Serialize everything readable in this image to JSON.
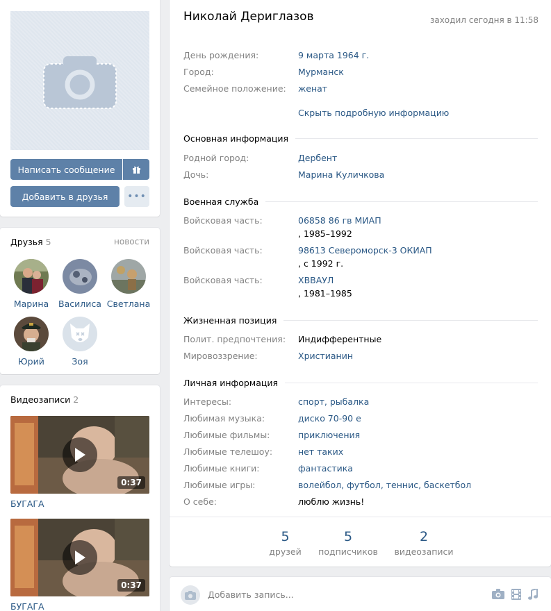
{
  "profile": {
    "name": "Николай Дериглазов",
    "online": "заходил сегодня в 11:58",
    "short_info": [
      {
        "label": "День рождения:",
        "value": "9 марта 1964 г."
      },
      {
        "label": "Город:",
        "value": "Мурманск"
      },
      {
        "label": "Семейное положение:",
        "value": "женат"
      }
    ],
    "toggle_details": "Скрыть подробную информацию",
    "sections": {
      "main": {
        "title": "Основная информация",
        "rows": [
          {
            "label": "Родной город:",
            "value": "Дербент"
          },
          {
            "label": "Дочь:",
            "value": "Марина Куличкова"
          }
        ]
      },
      "military": {
        "title": "Военная служба",
        "rows": [
          {
            "label": "Войсковая часть:",
            "value": "06858 86 гв МИАП",
            "years": ", 1985–1992"
          },
          {
            "label": "Войсковая часть:",
            "value": "98613 Североморск-3 ОКИАП",
            "years": ", с 1992 г."
          },
          {
            "label": "Войсковая часть:",
            "value": "ХВВАУЛ",
            "years": ", 1981–1985"
          }
        ]
      },
      "life": {
        "title": "Жизненная позиция",
        "rows": [
          {
            "label": "Полит. предпочтения:",
            "value": "Индифферентные"
          },
          {
            "label": "Мировоззрение:",
            "value": "Христианин"
          }
        ]
      },
      "personal": {
        "title": "Личная информация",
        "rows": [
          {
            "label": "Интересы:",
            "value": "спорт, рыбалка"
          },
          {
            "label": "Любимая музыка:",
            "value": "диско 70-90 е"
          },
          {
            "label": "Любимые фильмы:",
            "value": "приключения"
          },
          {
            "label": "Любимые телешоу:",
            "value": "нет таких"
          },
          {
            "label": "Любимые книги:",
            "value": "фантастика"
          },
          {
            "label": "Любимые игры:",
            "value": "волейбол, футбол, теннис, баскетбол"
          },
          {
            "label": "О себе:",
            "value": "люблю жизнь!"
          }
        ]
      }
    },
    "stats": [
      {
        "count": "5",
        "label": "друзей"
      },
      {
        "count": "5",
        "label": "подписчиков"
      },
      {
        "count": "2",
        "label": "видеозаписи"
      }
    ]
  },
  "actions": {
    "message": "Написать сообщение",
    "add_friend": "Добавить в друзья",
    "more": "•••"
  },
  "friends": {
    "title": "Друзья",
    "count": "5",
    "link": "новости",
    "items": [
      {
        "name": "Марина"
      },
      {
        "name": "Василиса"
      },
      {
        "name": "Светлана"
      },
      {
        "name": "Юрий"
      },
      {
        "name": "Зоя"
      }
    ]
  },
  "videos": {
    "title": "Видеозаписи",
    "count": "2",
    "items": [
      {
        "title": "БУГАГА",
        "duration": "0:37"
      },
      {
        "title": "БУГАГА",
        "duration": "0:37"
      }
    ]
  },
  "post": {
    "placeholder": "Добавить запись..."
  },
  "colors": {
    "background": "#edeef0",
    "button": "#5e81a8",
    "link": "#2a5885",
    "label": "#828282"
  }
}
